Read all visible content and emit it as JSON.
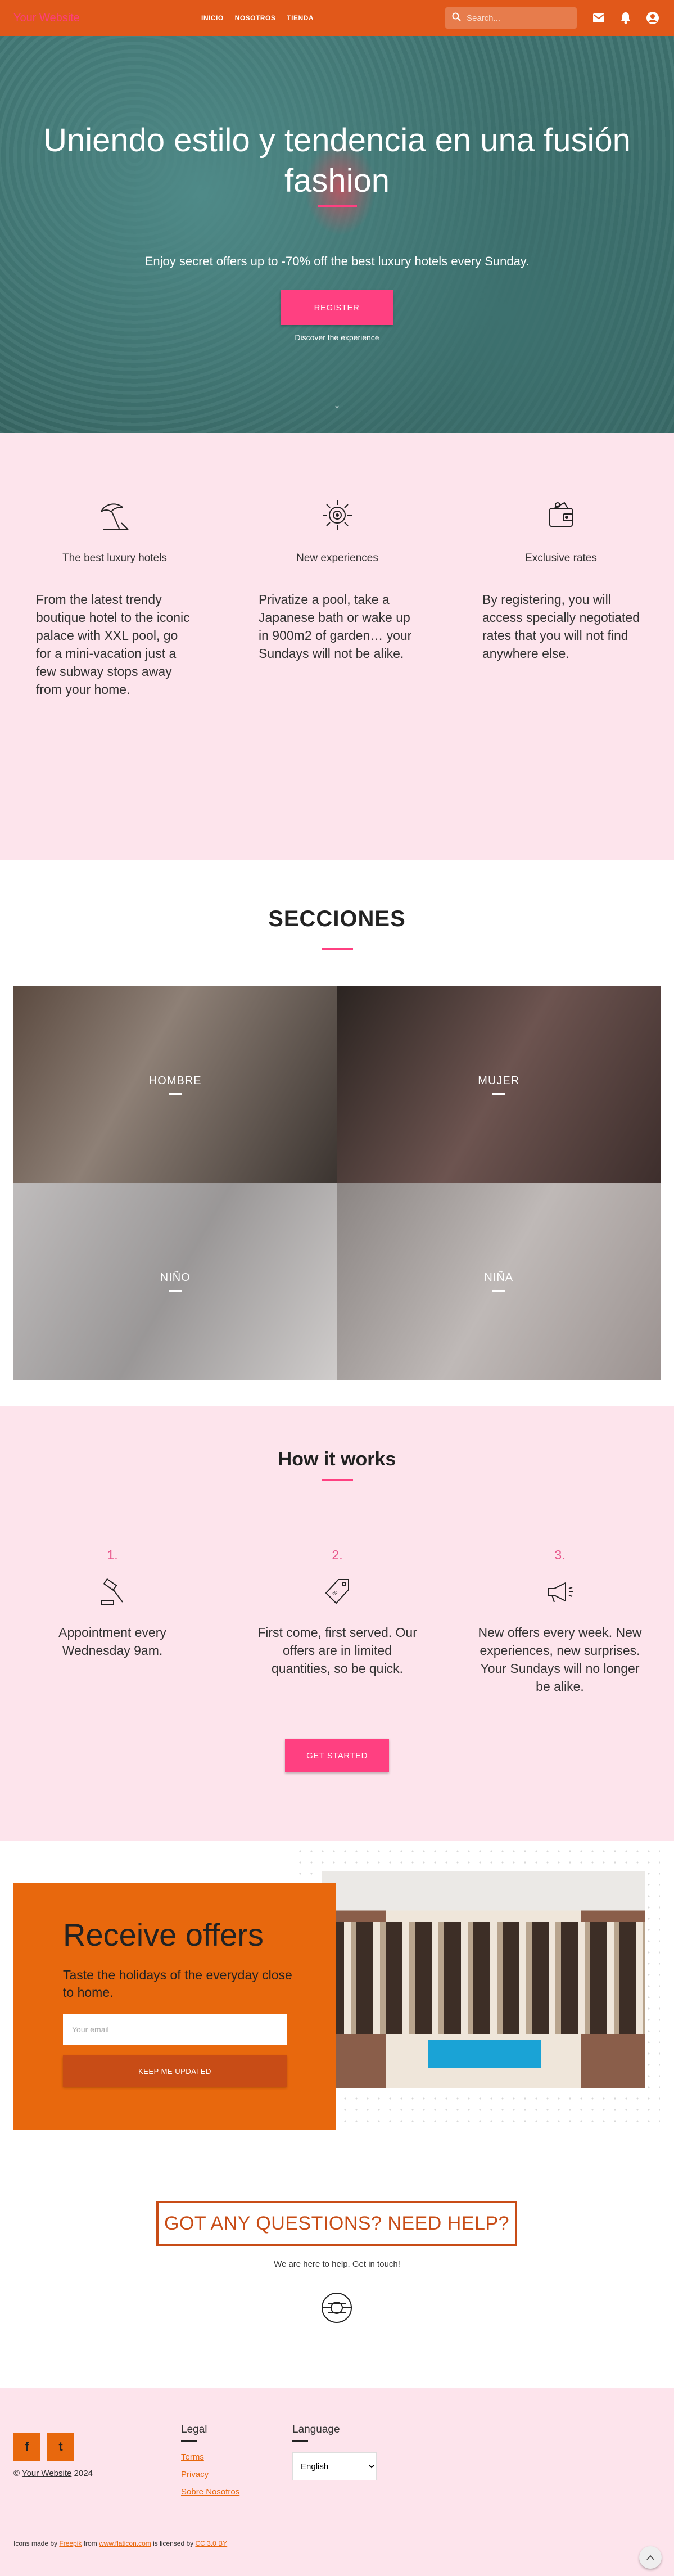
{
  "header": {
    "brand": "Your Website",
    "nav": [
      "INICIO",
      "NOSOTROS",
      "TIENDA"
    ],
    "search_placeholder": "Search...",
    "icons": [
      "mail-icon",
      "bell-icon",
      "account-icon"
    ]
  },
  "hero": {
    "title": "Uniendo estilo y tendencia en una fusión fashion",
    "subtitle": "Enjoy secret offers up to -70% off the best luxury hotels every Sunday.",
    "cta": "REGISTER",
    "link": "Discover the experience",
    "arrow": "↓"
  },
  "features": [
    {
      "icon": "beach-umbrella-icon",
      "title": "The best luxury hotels",
      "text": "From the latest trendy boutique hotel to the iconic palace with XXL pool, go for a mini-vacation just a few subway stops away from your home."
    },
    {
      "icon": "sun-compass-icon",
      "title": "New experiences",
      "text": "Privatize a pool, take a Japanese bath or wake up in 900m2 of garden… your Sundays will not be alike."
    },
    {
      "icon": "wallet-icon",
      "title": "Exclusive rates",
      "text": "By registering, you will access specially negotiated rates that you will not find anywhere else."
    }
  ],
  "secciones": {
    "title": "SECCIONES",
    "tiles": [
      "HOMBRE",
      "MUJER",
      "NIÑO",
      "NIÑA"
    ]
  },
  "how": {
    "title": "How it works",
    "steps": [
      {
        "num": "1.",
        "icon": "gavel-icon",
        "text": "Appointment every Wednesday 9am."
      },
      {
        "num": "2.",
        "icon": "price-tag-icon",
        "text": "First come, first served. Our offers are in limited quantities, so be quick."
      },
      {
        "num": "3.",
        "icon": "megaphone-icon",
        "text": "New offers every week. New experiences, new surprises. Your Sundays will no longer be alike."
      }
    ],
    "cta": "GET STARTED"
  },
  "offers": {
    "title": "Receive offers",
    "lead": "Taste the holidays of the everyday close to home.",
    "email_placeholder": "Your email",
    "button": "KEEP ME UPDATED"
  },
  "help": {
    "button": "GOT ANY QUESTIONS? NEED HELP?",
    "text": "We are here to help. Get in touch!"
  },
  "footer": {
    "social": [
      "f",
      "t"
    ],
    "copyright_prefix": "© ",
    "copyright_link": "Your Website",
    "copyright_year": " 2024",
    "legal_title": "Legal",
    "legal_links": [
      "Terms",
      "Privacy",
      "Sobre Nosotros"
    ],
    "language_title": "Language",
    "language_selected": "English",
    "credit_1": "Icons made by ",
    "credit_freepik": "Freepik",
    "credit_2": " from ",
    "credit_flaticon": "www.flaticon.com",
    "credit_3": " is licensed by ",
    "credit_cc": "CC 3.0 BY"
  }
}
